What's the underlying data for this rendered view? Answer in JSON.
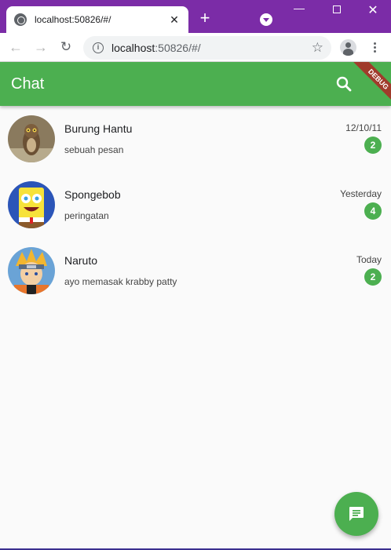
{
  "browser": {
    "tab_title": "localhost:50826/#/",
    "new_tab": "+",
    "close_tab": "✕",
    "url_host": "localhost",
    "url_rest": ":50826/#/"
  },
  "app": {
    "title": "Chat",
    "debug_label": "DEBUG",
    "accent_color": "#4caf50"
  },
  "chats": [
    {
      "name": "Burung Hantu",
      "message": "sebuah pesan",
      "time": "12/10/11",
      "unread": "2",
      "avatar": "owl"
    },
    {
      "name": "Spongebob",
      "message": "peringatan",
      "time": "Yesterday",
      "unread": "4",
      "avatar": "spongebob"
    },
    {
      "name": "Naruto",
      "message": "ayo memasak krabby patty",
      "time": "Today",
      "unread": "2",
      "avatar": "naruto"
    }
  ],
  "icons": {
    "search": "search-icon",
    "fab": "message-icon",
    "back": "arrow-back-icon",
    "forward": "arrow-forward-icon",
    "reload": "reload-icon",
    "star": "star-icon",
    "profile": "profile-icon",
    "menu": "more-vert-icon"
  }
}
